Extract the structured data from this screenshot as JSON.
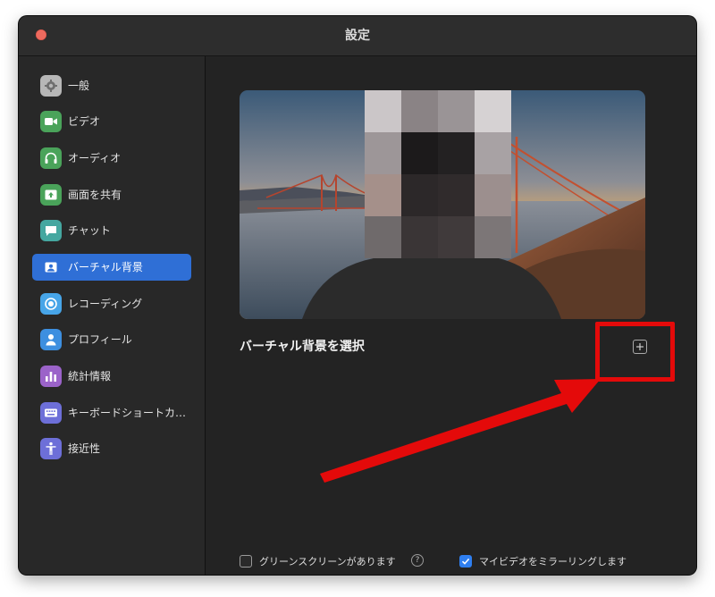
{
  "window": {
    "title": "設定"
  },
  "sidebar": {
    "items": [
      {
        "label": "一般",
        "icon": "gear-icon",
        "color": "#b7b7b7",
        "active": false
      },
      {
        "label": "ビデオ",
        "icon": "video-camera-icon",
        "color": "#4aa35a",
        "active": false
      },
      {
        "label": "オーディオ",
        "icon": "headphones-icon",
        "color": "#4aa35a",
        "active": false
      },
      {
        "label": "画面を共有",
        "icon": "share-screen-icon",
        "color": "#4aa35a",
        "active": false
      },
      {
        "label": "チャット",
        "icon": "chat-bubble-icon",
        "color": "#45a7a0",
        "active": false
      },
      {
        "label": "バーチャル背景",
        "icon": "virtual-background-icon",
        "color": "#2f6fd6",
        "active": true
      },
      {
        "label": "レコーディング",
        "icon": "record-icon",
        "color": "#47a5e8",
        "active": false
      },
      {
        "label": "プロフィール",
        "icon": "person-icon",
        "color": "#3d8fe0",
        "active": false
      },
      {
        "label": "統計情報",
        "icon": "bar-chart-icon",
        "color": "#9b63c9",
        "active": false
      },
      {
        "label": "キーボードショートカ…",
        "icon": "keyboard-icon",
        "color": "#6d6fd8",
        "active": false
      },
      {
        "label": "接近性",
        "icon": "accessibility-icon",
        "color": "#6d6fd8",
        "active": false
      }
    ]
  },
  "main": {
    "section_label": "バーチャル背景を選択",
    "add_icon": "plus-icon",
    "options": {
      "green_screen": {
        "label": "グリーンスクリーンがあります",
        "checked": false,
        "help": "?"
      },
      "mirror": {
        "label": "マイビデオをミラーリングします",
        "checked": true
      }
    }
  },
  "colors": {
    "accent": "#2f6fd6",
    "highlight": "#e40a0a",
    "checkbox_checked": "#2f7ff0"
  }
}
